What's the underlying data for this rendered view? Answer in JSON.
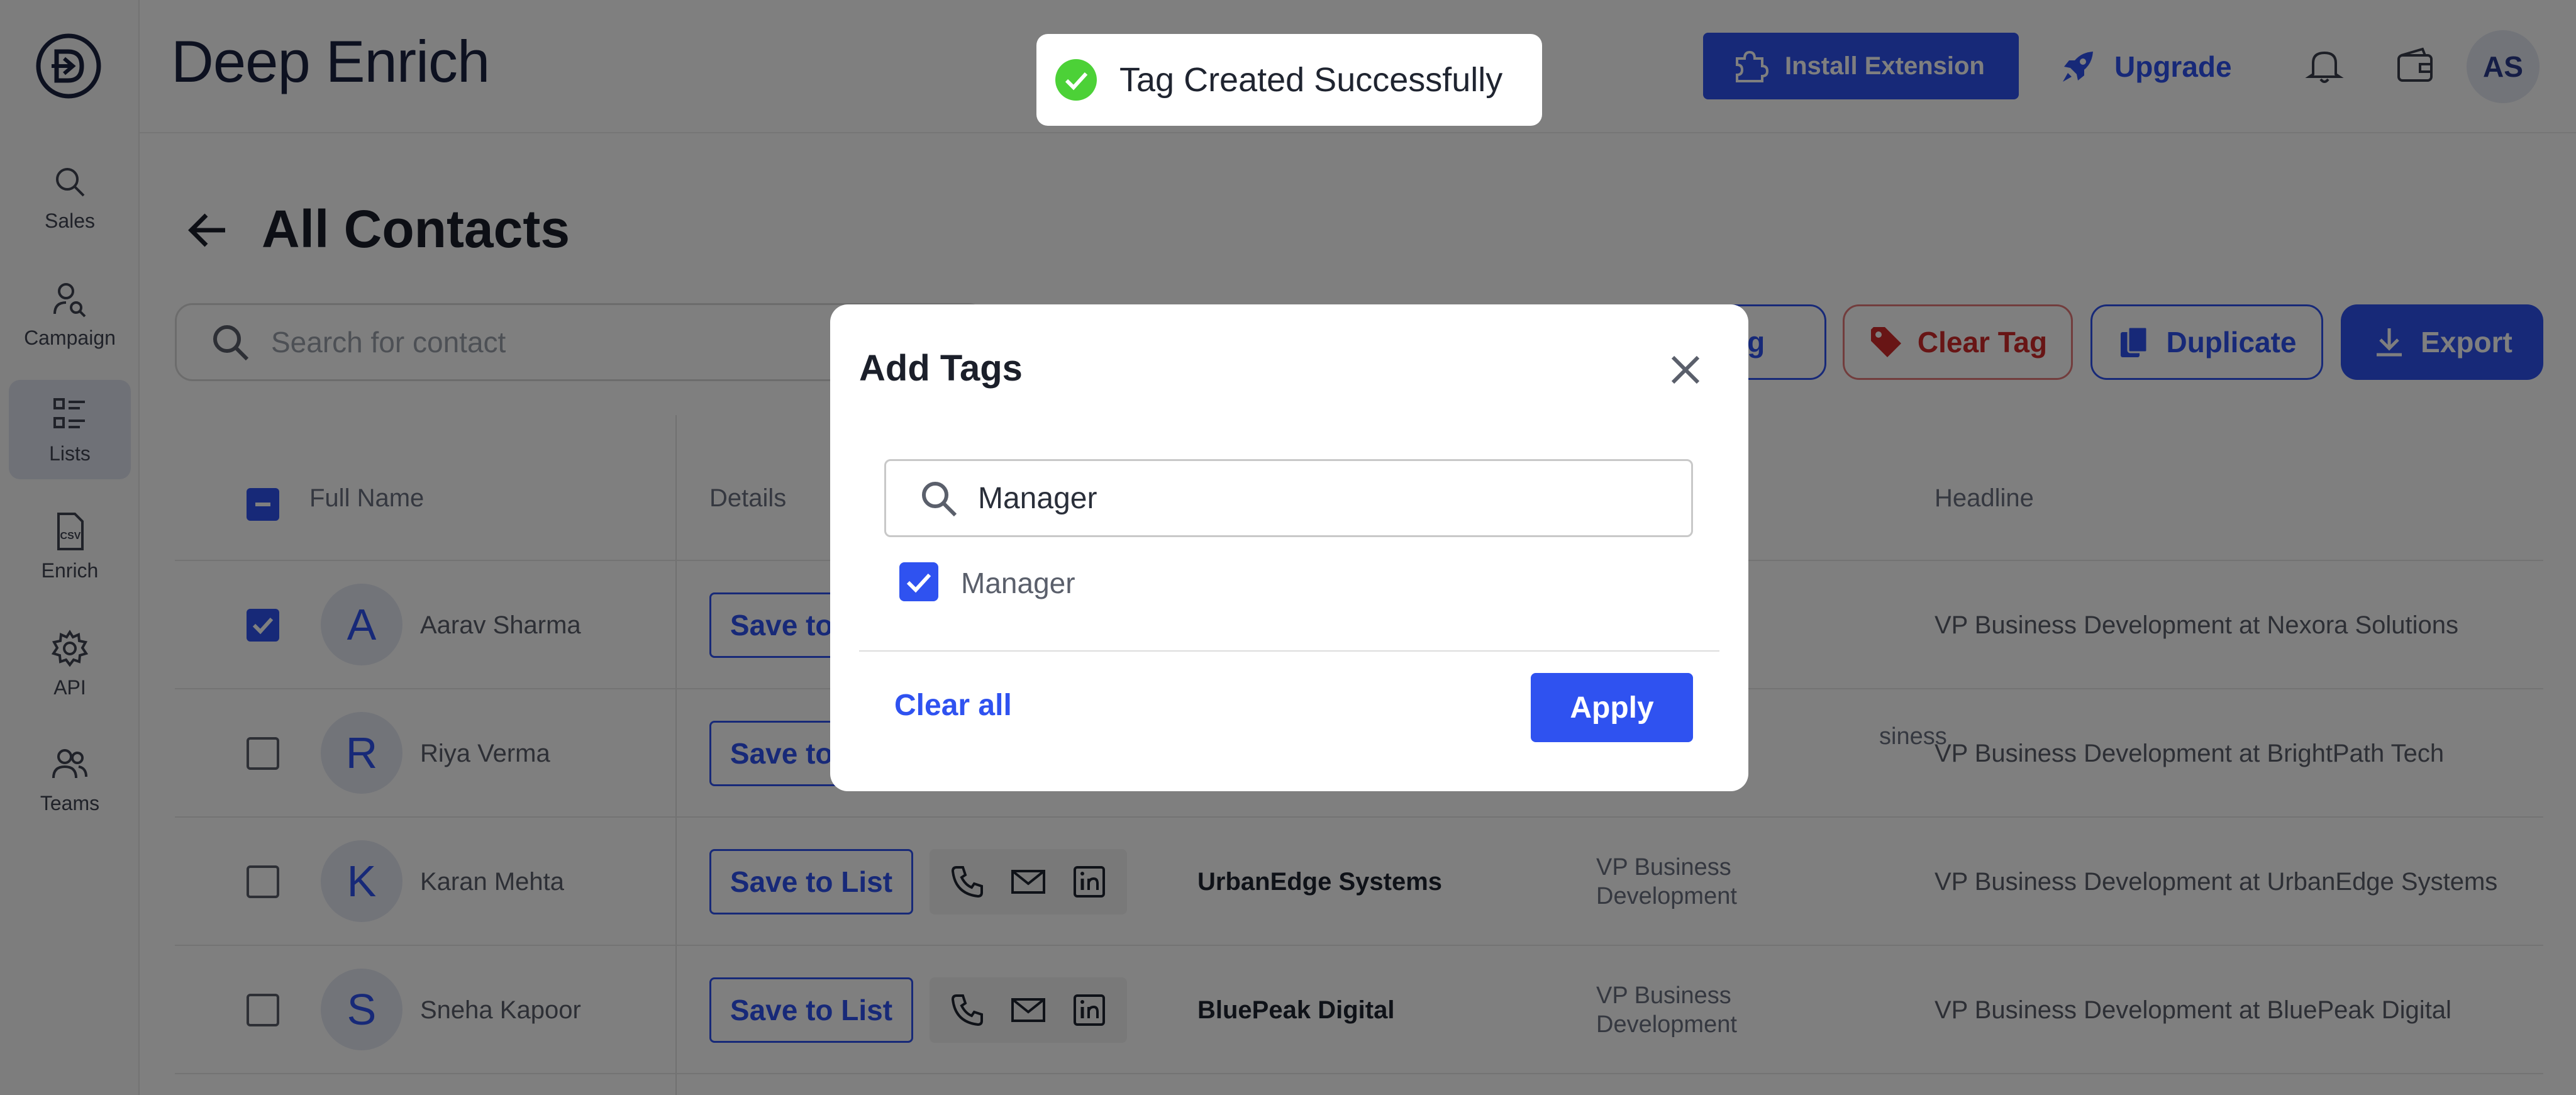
{
  "app": {
    "brand": "Deep Enrich"
  },
  "sidebar": {
    "items": [
      {
        "label": "Sales",
        "icon": "search-icon"
      },
      {
        "label": "Campaign",
        "icon": "user-search-icon"
      },
      {
        "label": "Lists",
        "icon": "list-icon",
        "active": true
      },
      {
        "label": "Enrich",
        "icon": "csv-file-icon"
      },
      {
        "label": "API",
        "icon": "gear-icon"
      },
      {
        "label": "Teams",
        "icon": "users-icon"
      }
    ]
  },
  "header": {
    "install_label": "Install Extension",
    "upgrade_label": "Upgrade",
    "avatar_initials": "AS"
  },
  "toast": {
    "message": "Tag Created Successfully"
  },
  "main": {
    "title": "All Contacts",
    "search_placeholder": "Search for contact",
    "actions": {
      "tag": "Tag",
      "clear_tag": "Clear Tag",
      "duplicate": "Duplicate",
      "export": "Export"
    }
  },
  "table": {
    "columns": {
      "full_name": "Full Name",
      "details": "Details",
      "headline": "Headline"
    },
    "rows": [
      {
        "initial": "A",
        "name": "Aarav Sharma",
        "save": "Save to List",
        "company": "",
        "title": "",
        "headline": "VP Business Development at Nexora Solutions",
        "checked": true
      },
      {
        "initial": "R",
        "name": "Riya Verma",
        "save": "Save to List",
        "company": "",
        "title": "siness",
        "headline": "VP Business Development at BrightPath Tech",
        "checked": false
      },
      {
        "initial": "K",
        "name": "Karan Mehta",
        "save": "Save to List",
        "company": "UrbanEdge Systems",
        "title": "VP Business Development",
        "headline": "VP Business Development at UrbanEdge Systems",
        "checked": false
      },
      {
        "initial": "S",
        "name": "Sneha Kapoor",
        "save": "Save to List",
        "company": "BluePeak Digital",
        "title": "VP Business Development",
        "headline": "VP Business Development at BluePeak Digital",
        "checked": false
      }
    ]
  },
  "modal": {
    "title": "Add Tags",
    "search_value": "Manager",
    "option_label": "Manager",
    "clear_all": "Clear all",
    "apply": "Apply"
  },
  "colors": {
    "primary": "#2f52f0",
    "danger": "#d12a2a",
    "success": "#4cd137"
  }
}
